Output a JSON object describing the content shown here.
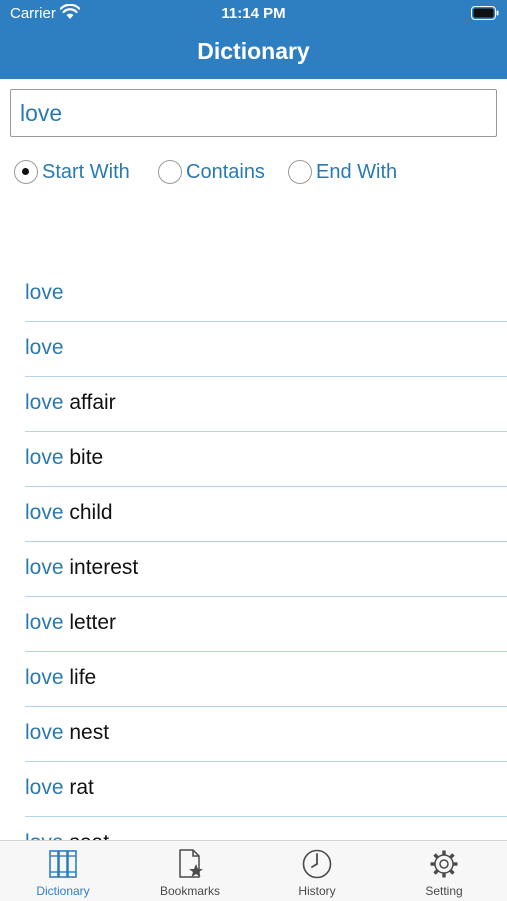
{
  "status_bar": {
    "carrier": "Carrier",
    "time": "11:14 PM"
  },
  "header": {
    "title": "Dictionary",
    "color": "#2e7fc2"
  },
  "search": {
    "value": "love"
  },
  "filters": {
    "options": [
      {
        "label": "Start With",
        "selected": true
      },
      {
        "label": "Contains",
        "selected": false
      },
      {
        "label": "End With",
        "selected": false
      }
    ]
  },
  "results": [
    {
      "match": "love",
      "rest": ""
    },
    {
      "match": "love",
      "rest": ""
    },
    {
      "match": "love",
      "rest": " affair"
    },
    {
      "match": "love",
      "rest": " bite"
    },
    {
      "match": "love",
      "rest": " child"
    },
    {
      "match": "love",
      "rest": " interest"
    },
    {
      "match": "love",
      "rest": " letter"
    },
    {
      "match": "love",
      "rest": " life"
    },
    {
      "match": "love",
      "rest": " nest"
    },
    {
      "match": "love",
      "rest": " rat"
    },
    {
      "match": "love",
      "rest": " seat"
    }
  ],
  "tabs": [
    {
      "label": "Dictionary",
      "icon": "books-icon",
      "active": true
    },
    {
      "label": "Bookmarks",
      "icon": "bookmark-document-icon",
      "active": false
    },
    {
      "label": "History",
      "icon": "clock-icon",
      "active": false
    },
    {
      "label": "Setting",
      "icon": "gear-icon",
      "active": false
    }
  ],
  "colors": {
    "accent": "#2e7fc2",
    "match_text": "#2a7ab0",
    "divider": "#b7d3ea"
  }
}
